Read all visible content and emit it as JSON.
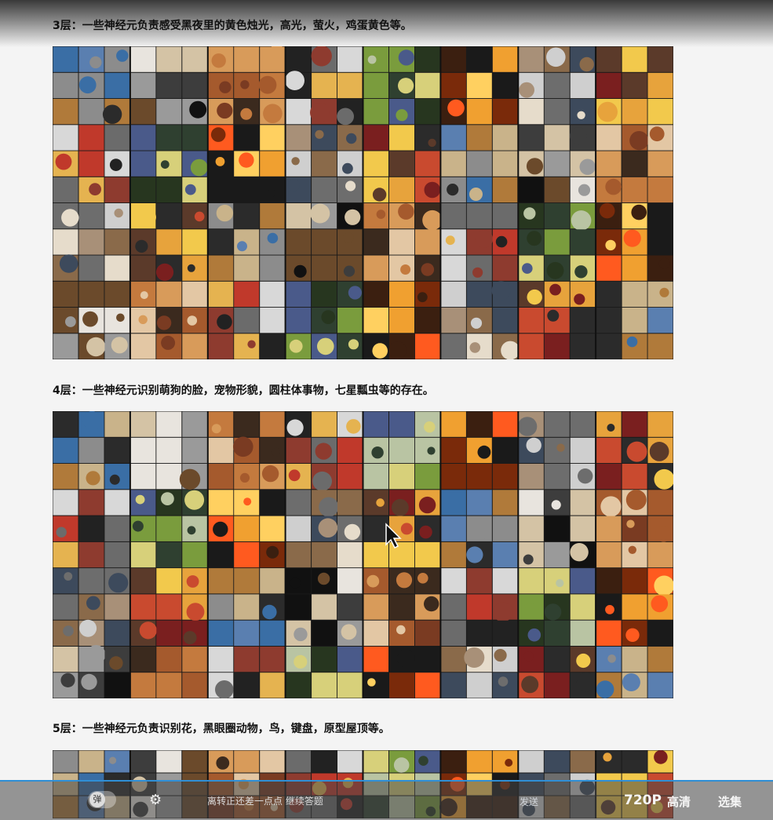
{
  "sections": [
    {
      "caption": "3层：一些神经元负责感受黑夜里的黄色烛光，高光，萤火，鸡蛋黄色等。"
    },
    {
      "caption": "4层：一些神经元识别萌狗的脸，宠物形貌，圆柱体事物，七星瓢虫等的存在。"
    },
    {
      "caption": "5层：一些神经元负责识别花，黑眼圈动物，鸟，键盘，原型屋顶等。"
    }
  ],
  "player": {
    "danmu_toggle_label": "弹",
    "danmu_placeholder": "离转正还差一点点 继续答题",
    "send_label": "发送",
    "resolution": "720P",
    "quality": "高清",
    "playlist": "选集"
  },
  "icons": {
    "settings": "gear-icon",
    "cursor": "mouse-cursor-icon"
  }
}
